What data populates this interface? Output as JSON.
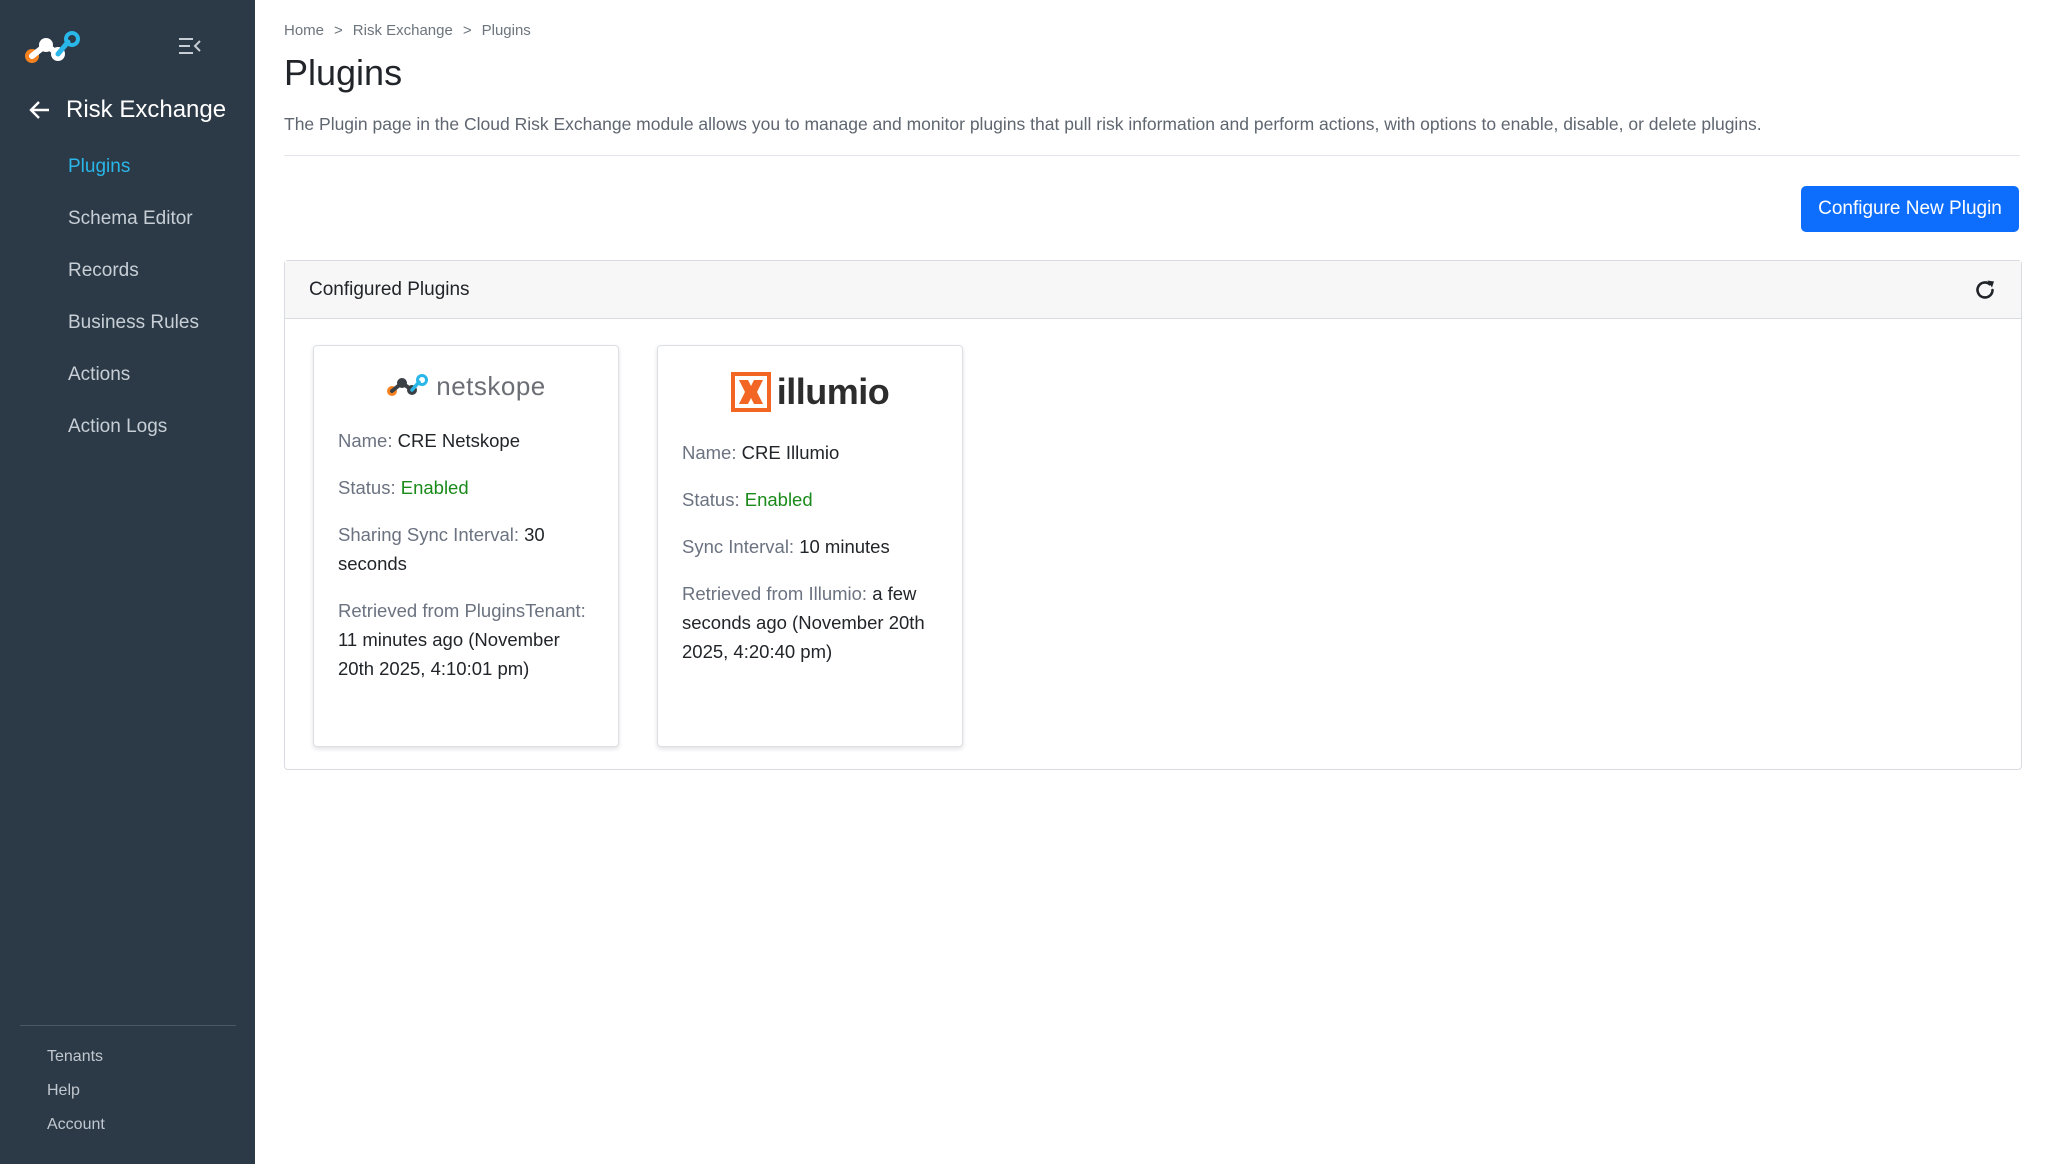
{
  "sidebar": {
    "module_title": "Risk Exchange",
    "items": [
      {
        "label": "Plugins"
      },
      {
        "label": "Schema Editor"
      },
      {
        "label": "Records"
      },
      {
        "label": "Business Rules"
      },
      {
        "label": "Actions"
      },
      {
        "label": "Action Logs"
      }
    ],
    "bottom_items": [
      {
        "label": "Tenants"
      },
      {
        "label": "Help"
      },
      {
        "label": "Account"
      }
    ]
  },
  "breadcrumb": {
    "items": [
      "Home",
      "Risk Exchange",
      "Plugins"
    ],
    "separator": ">"
  },
  "page": {
    "title": "Plugins",
    "description": "The Plugin page in the Cloud Risk Exchange module allows you to manage and monitor plugins that pull risk information and perform actions, with options to enable, disable, or delete plugins."
  },
  "actions": {
    "configure_label": "Configure New Plugin"
  },
  "panel": {
    "title": "Configured Plugins"
  },
  "plugins": [
    {
      "logo_text": "netskope",
      "name_label": "Name:",
      "name": "CRE Netskope",
      "status_label": "Status:",
      "status": "Enabled",
      "interval_label": "Sharing Sync Interval:",
      "interval": "30 seconds",
      "retrieved_label": "Retrieved from PluginsTenant:",
      "retrieved": "11 minutes ago (November 20th 2025, 4:10:01 pm)"
    },
    {
      "logo_text": "illumio",
      "name_label": "Name:",
      "name": "CRE Illumio",
      "status_label": "Status:",
      "status": "Enabled",
      "interval_label": "Sync Interval:",
      "interval": "10 minutes",
      "retrieved_label": "Retrieved from Illumio:",
      "retrieved": "a few seconds ago (November 20th 2025, 4:20:40 pm)"
    }
  ],
  "colors": {
    "sidebar_bg": "#2c3a47",
    "active_nav": "#29b6e8",
    "primary": "#0d6efd",
    "enabled": "#1a8a1a",
    "illumio_orange": "#f26522"
  }
}
